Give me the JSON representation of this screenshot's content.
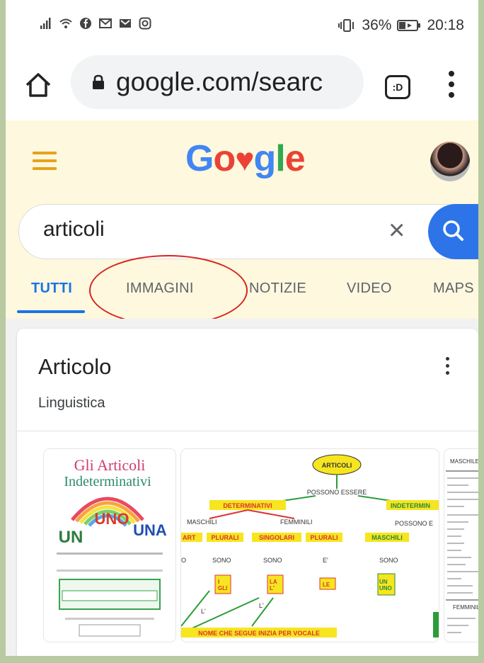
{
  "status_bar": {
    "battery_pct": "36%",
    "time": "20:18",
    "left_icons": [
      "signal-icon",
      "wifi-icon",
      "facebook-icon",
      "gmail-icon",
      "gmail-icon",
      "instagram-icon"
    ]
  },
  "browser": {
    "url": "google.com/searc",
    "tab_switcher_label": ":D"
  },
  "google": {
    "logo_text": [
      "G",
      "o",
      "♥",
      "g",
      "l",
      "e"
    ],
    "search_query": "articoli",
    "clear_symbol": "×",
    "tabs": [
      "TUTTI",
      "IMMAGINI",
      "NOTIZIE",
      "VIDEO",
      "MAPS"
    ],
    "active_tab": "TUTTI"
  },
  "knowledge_card": {
    "title": "Articolo",
    "subtitle": "Linguistica"
  },
  "thumbnails": {
    "t1": {
      "title": "Gli Articoli",
      "subtitle": "Indeterminativi",
      "word_uno": "UNO",
      "word_un": "UN",
      "word_una": "UNA"
    },
    "t2": {
      "root": "ARTICOLI",
      "possono": "POSSONO ESSERE",
      "det": "DETERMINATIVI",
      "indet": "INDETERMIN",
      "possono2": "POSSONO E",
      "maschili": "MASCHILI",
      "femminili": "FEMMINILI",
      "plurali1": "PLURALI",
      "singolari": "SINGOLARI",
      "plurali2": "PLURALI",
      "maschili2": "MASCHILI",
      "art": "ART",
      "sono1": "SONO",
      "sono2": "SONO",
      "sono3": "SONO",
      "e": "E'",
      "b_i_gli": "I\nGLI",
      "b_la": "LA\nL'",
      "b_le": "LE",
      "b_un": "UN\nUNO",
      "l1": "L'",
      "l2": "L'",
      "footer": "NOME CHE SEGUE INIZIA PER VOCALE",
      "o": "O"
    },
    "t3": {
      "header": "MASCHILE -",
      "footer": "FEMMINILE -"
    }
  },
  "colors": {
    "google_blue": "#4285f4",
    "google_red": "#ea4335",
    "google_yellow": "#fbbc05",
    "google_green": "#34a853",
    "active_tab": "#1a73e8",
    "annotation_red": "#d8231f",
    "header_bg": "#fdf8de",
    "hamburger": "#e7a21a"
  }
}
